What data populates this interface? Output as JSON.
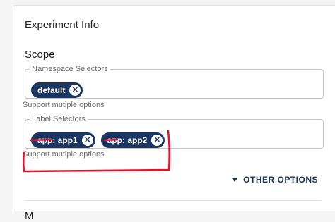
{
  "panel": {
    "title": "Experiment Info",
    "section_title": "Scope",
    "cut_heading": "M"
  },
  "namespace_selectors": {
    "label": "Namespace Selectors",
    "chips": [
      {
        "text": "default",
        "delete_icon": "close-circle-icon"
      }
    ],
    "helper": "Support mutiple options"
  },
  "label_selectors": {
    "label": "Label Selectors",
    "chips": [
      {
        "text": "app: app1",
        "delete_icon": "close-circle-icon"
      },
      {
        "text": "app: app2",
        "delete_icon": "close-circle-icon"
      }
    ],
    "helper": "Support mutiple options"
  },
  "other_options": {
    "label": "OTHER OPTIONS",
    "icon": "caret-down-icon"
  },
  "colors": {
    "chip_bg": "#1a3562",
    "accent": "#1a3562",
    "annotation": "#e8102a"
  }
}
